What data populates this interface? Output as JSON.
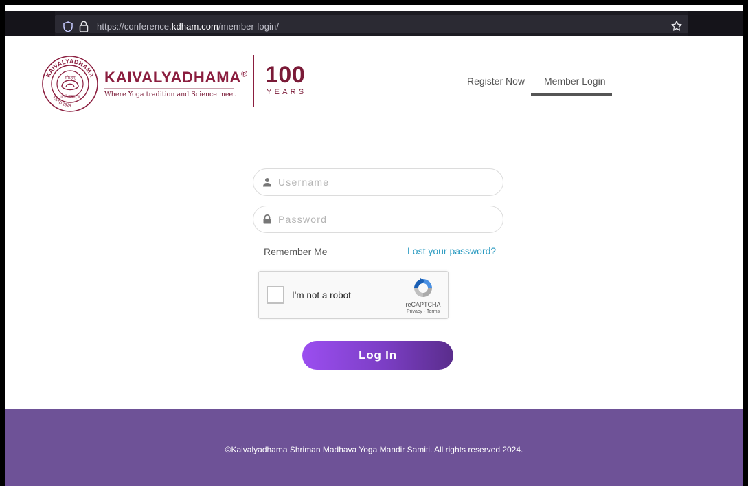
{
  "browser": {
    "url_prefix": "https://conference.",
    "url_domain": "kdham.com",
    "url_path": "/member-login/"
  },
  "header": {
    "brand_name": "KAIVALYADHAMA",
    "brand_reg": "®",
    "tagline": "Where Yoga tradition and Science meet",
    "centenary_number": "100",
    "centenary_word": "YEARS",
    "emblem_top": "KAIVALYADHAMA",
    "emblem_center": "सोऽहम्",
    "emblem_lower": "॥ ॐ तत्सत् ॥",
    "emblem_estd": "ESTD 1924",
    "nav": {
      "register": "Register Now",
      "login": "Member Login",
      "active": "Member Login"
    }
  },
  "form": {
    "username_placeholder": "Username",
    "password_placeholder": "Password",
    "remember_label": "Remember Me",
    "lost_password": "Lost your password?",
    "recaptcha": {
      "label": "I'm not a robot",
      "brand": "reCAPTCHA",
      "links": "Privacy - Terms"
    },
    "submit": "Log In"
  },
  "footer": {
    "copyright": "©Kaivalyadhama Shriman Madhava Yoga Mandir Samiti. All rights reserved 2024."
  },
  "colors": {
    "brand": "#8b1e3f",
    "link": "#2c9bc1",
    "footer_bg": "#6e5297",
    "button_start": "#9b4ef0",
    "button_end": "#5a2d8c"
  }
}
